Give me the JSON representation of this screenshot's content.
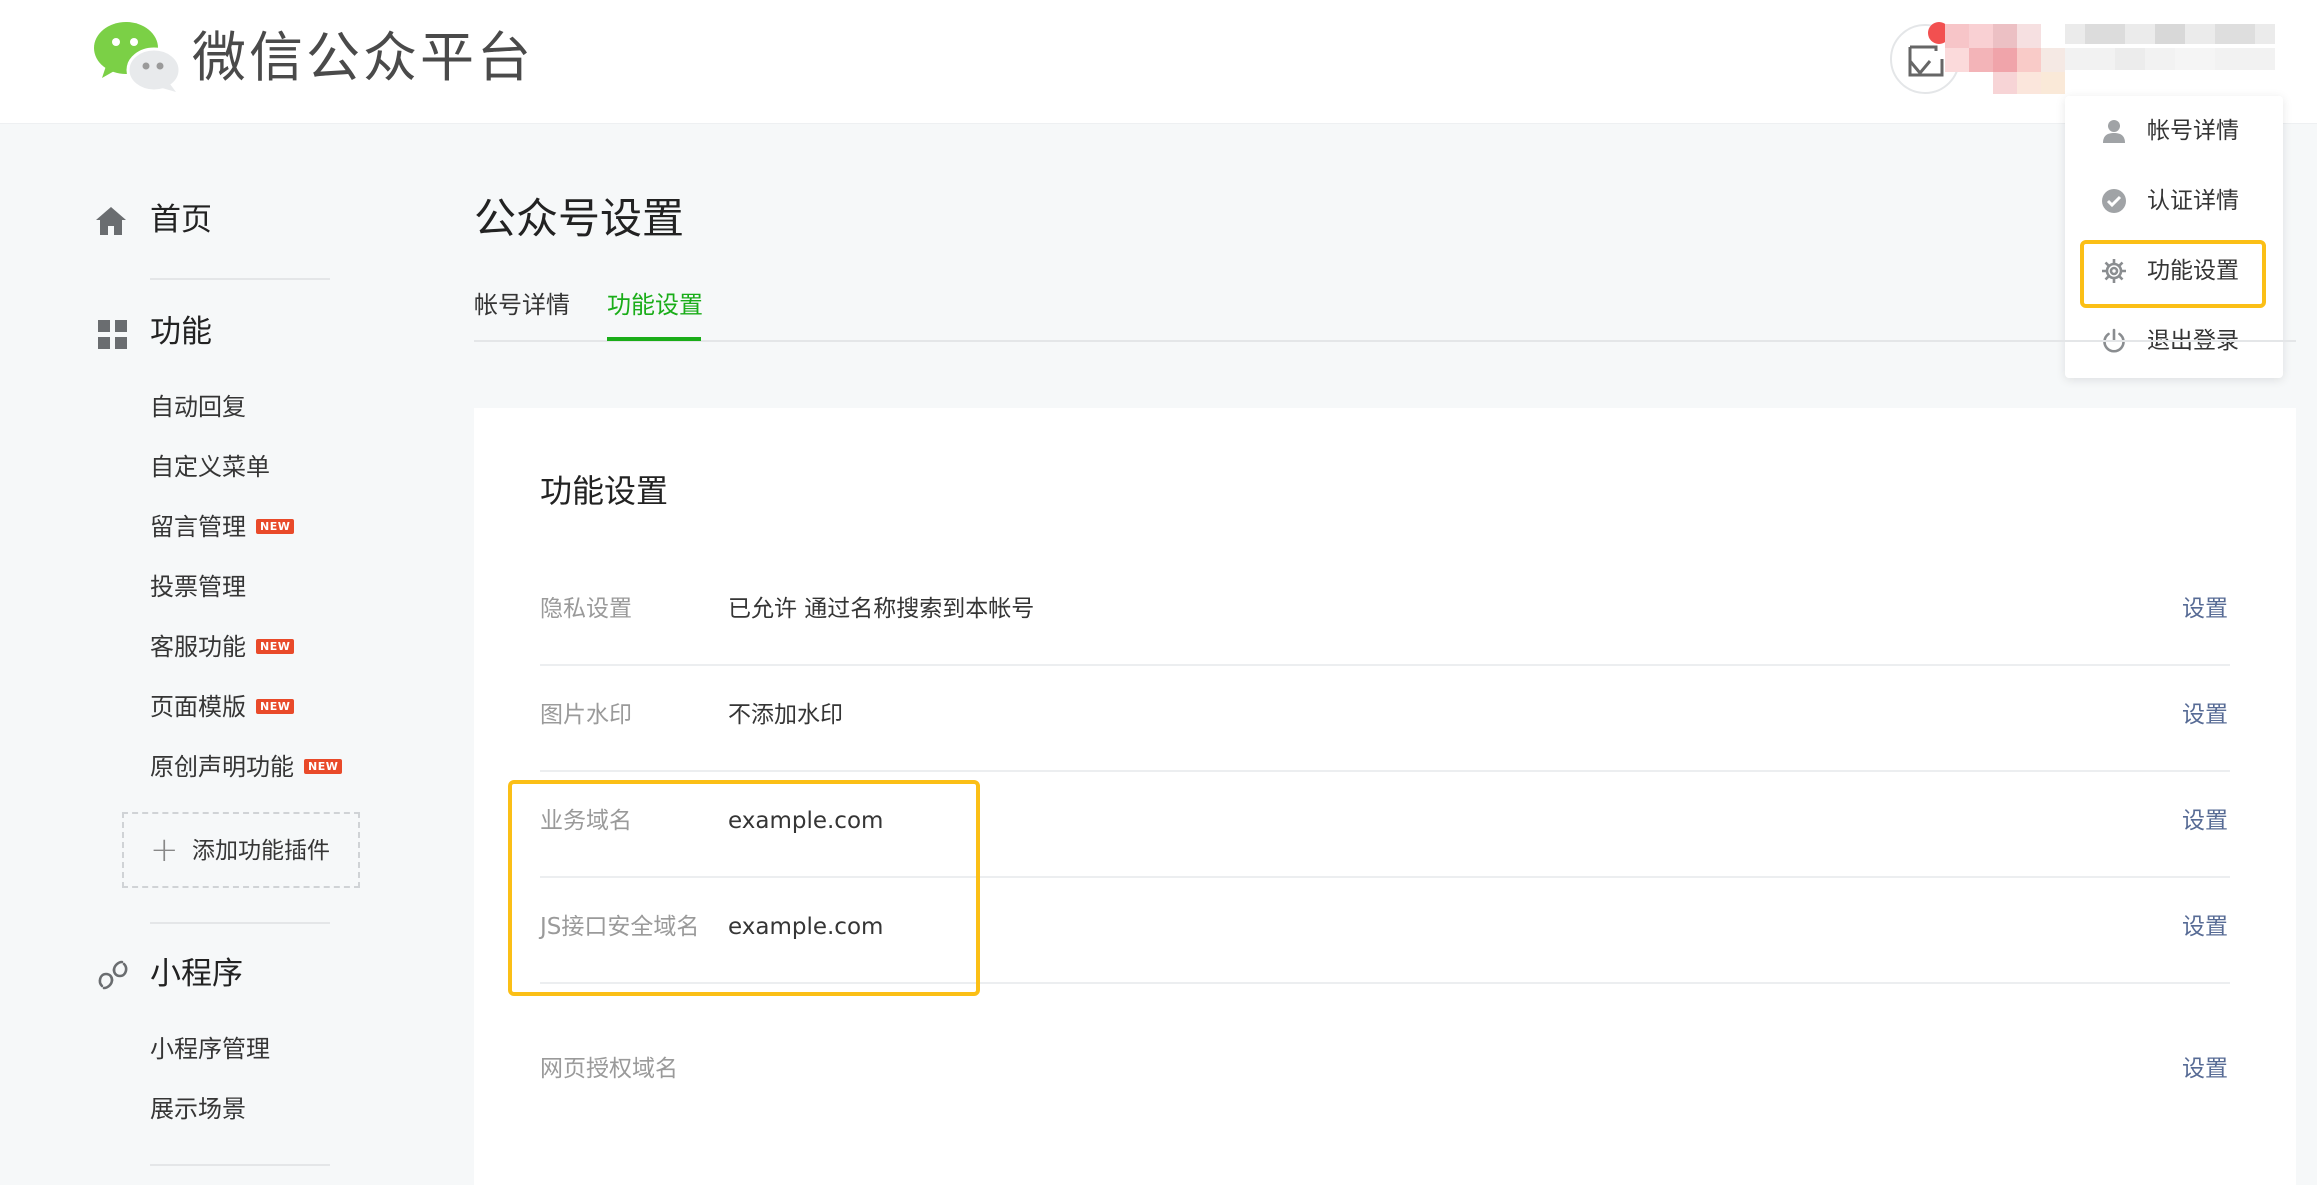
{
  "header": {
    "brand": "微信公众平台",
    "account_name_blurred": true,
    "accent_color": "#1aad19",
    "notification_color": "#f25050"
  },
  "dropdown": {
    "items": [
      {
        "icon": "user-icon",
        "label": "帐号详情"
      },
      {
        "icon": "verified-check-icon",
        "label": "认证详情"
      },
      {
        "icon": "gear-icon",
        "label": "功能设置",
        "highlighted": true
      },
      {
        "icon": "power-icon",
        "label": "退出登录"
      }
    ]
  },
  "sidebar": {
    "home": {
      "icon": "home-icon",
      "label": "首页"
    },
    "features": {
      "icon": "grid-icon",
      "label": "功能",
      "items": [
        {
          "label": "自动回复",
          "new": false
        },
        {
          "label": "自定义菜单",
          "new": false
        },
        {
          "label": "留言管理",
          "new": true
        },
        {
          "label": "投票管理",
          "new": false
        },
        {
          "label": "客服功能",
          "new": true
        },
        {
          "label": "页面模版",
          "new": true
        },
        {
          "label": "原创声明功能",
          "new": true
        }
      ],
      "add_plugin": "添加功能插件",
      "new_badge": "NEW"
    },
    "miniprogram": {
      "icon": "link-icon",
      "label": "小程序",
      "items": [
        {
          "label": "小程序管理"
        },
        {
          "label": "展示场景"
        }
      ]
    }
  },
  "main": {
    "page_title": "公众号设置",
    "tabs": [
      {
        "label": "帐号详情",
        "active": false
      },
      {
        "label": "功能设置",
        "active": true
      }
    ],
    "panel": {
      "title": "功能设置",
      "rows": [
        {
          "label": "隐私设置",
          "value": "已允许 通过名称搜索到本帐号",
          "action": "设置"
        },
        {
          "label": "图片水印",
          "value": "不添加水印",
          "action": "设置"
        },
        {
          "label": "业务域名",
          "value": "example.com",
          "action": "设置"
        },
        {
          "label": "JS接口安全域名",
          "value": "example.com",
          "action": "设置"
        },
        {
          "label": "网页授权域名",
          "value": "",
          "action": "设置"
        }
      ]
    }
  },
  "annotation": {
    "highlight_color": "#fbbf16"
  }
}
